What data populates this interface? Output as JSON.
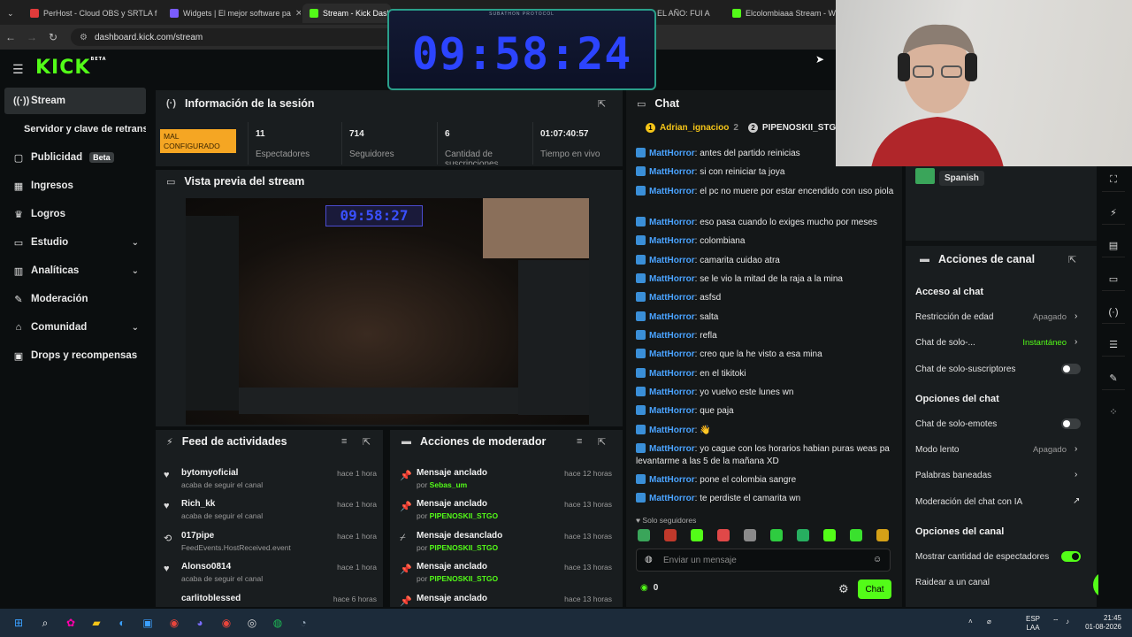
{
  "browser": {
    "tabs": [
      {
        "label": "PerHost - Cloud OBS y SRTLA f",
        "favicon_color": "#e23b3b"
      },
      {
        "label": "Widgets | El mejor software pa",
        "favicon_color": "#7a5cff"
      },
      {
        "label": "Stream - Kick Dashbo",
        "favicon_color": "#53fc18"
      },
      {
        "label": "EL AÑO: FUI A",
        "favicon_color": "#ff2a2a"
      },
      {
        "label": "Elcolombiaaa Stream - Wat",
        "favicon_color": "#53fc18"
      }
    ],
    "url": "dashboard.kick.com/stream"
  },
  "logo": {
    "text": "KICK",
    "sup": "BETA"
  },
  "sidebar": {
    "items": [
      {
        "label": "Stream",
        "icon": "broadcast-icon"
      },
      {
        "label": "Servidor y clave de retransmisión",
        "icon": ""
      },
      {
        "label": "Publicidad",
        "icon": "ad-icon",
        "badge": "Beta"
      },
      {
        "label": "Ingresos",
        "icon": "chart-icon"
      },
      {
        "label": "Logros",
        "icon": "trophy-icon"
      },
      {
        "label": "Estudio",
        "icon": "studio-icon"
      },
      {
        "label": "Analíticas",
        "icon": "analytics-icon"
      },
      {
        "label": "Moderación",
        "icon": "wrench-icon"
      },
      {
        "label": "Comunidad",
        "icon": "community-icon"
      },
      {
        "label": "Drops y recompensas",
        "icon": "gift-icon"
      }
    ]
  },
  "session": {
    "title": "Información de la sesión",
    "status": "MAL CONFIGURADO",
    "stats": [
      {
        "value": "11",
        "label": "Espectadores"
      },
      {
        "value": "714",
        "label": "Seguidores"
      },
      {
        "value": "6",
        "label": "Cantidad de suscripciones"
      },
      {
        "value": "01:07:40:57",
        "label": "Tiempo en vivo"
      }
    ]
  },
  "preview": {
    "title": "Vista previa del stream",
    "mini_timer": "09:58:27"
  },
  "feed": {
    "title": "Feed de actividades",
    "items": [
      {
        "name": "bytomyoficial",
        "desc": "acaba de seguir el canal",
        "time": "hace 1 hora",
        "icon": "heart-icon"
      },
      {
        "name": "Rich_kk",
        "desc": "acaba de seguir el canal",
        "time": "hace 1 hora",
        "icon": "heart-icon"
      },
      {
        "name": "017pipe",
        "desc": "FeedEvents.HostReceived.event",
        "time": "hace 1 hora",
        "icon": "host-icon"
      },
      {
        "name": "Alonso0814",
        "desc": "acaba de seguir el canal",
        "time": "hace 1 hora",
        "icon": "heart-icon"
      },
      {
        "name": "carlitoblessed",
        "desc": "",
        "time": "hace 6 horas",
        "icon": "heart-icon"
      }
    ]
  },
  "modactions": {
    "title": "Acciones de moderador",
    "items": [
      {
        "action": "Mensaje anclado",
        "by": "Sebas_um",
        "time": "hace 12 horas",
        "icon": "pin-icon"
      },
      {
        "action": "Mensaje anclado",
        "by": "PIPENOSKII_STGO",
        "time": "hace 13 horas",
        "icon": "pin-icon"
      },
      {
        "action": "Mensaje desanclado",
        "by": "PIPENOSKII_STGO",
        "time": "hace 13 horas",
        "icon": "unpin-icon"
      },
      {
        "action": "Mensaje anclado",
        "by": "PIPENOSKII_STGO",
        "time": "hace 13 horas",
        "icon": "pin-icon"
      },
      {
        "action": "Mensaje anclado",
        "by": "",
        "time": "hace 13 horas",
        "icon": "pin-icon"
      }
    ],
    "by_prefix": "por"
  },
  "chat": {
    "title": "Chat",
    "top_users": [
      {
        "rank": "1",
        "name": "Adrian_ignacioo",
        "count": "2"
      },
      {
        "rank": "2",
        "name": "PIPENOSKII_STGO",
        "count": "1"
      }
    ],
    "messages": [
      {
        "user": "MattHorror",
        "text": "antes del partido reinicias"
      },
      {
        "user": "MattHorror",
        "text": "si con reiniciar ta joya"
      },
      {
        "user": "MattHorror",
        "text": "el pc no muere por estar encendido con uso piola"
      },
      {
        "user": "MattHorror",
        "text": "eso pasa cuando lo exiges mucho por meses"
      },
      {
        "user": "MattHorror",
        "text": "colombiana"
      },
      {
        "user": "MattHorror",
        "text": "camarita cuidao atra"
      },
      {
        "user": "MattHorror",
        "text": "se le vio la mitad de la raja a la mina"
      },
      {
        "user": "MattHorror",
        "text": "asfsd"
      },
      {
        "user": "MattHorror",
        "text": "salta"
      },
      {
        "user": "MattHorror",
        "text": "refla"
      },
      {
        "user": "MattHorror",
        "text": "creo que la he visto a esa mina"
      },
      {
        "user": "MattHorror",
        "text": "en el tikitoki"
      },
      {
        "user": "MattHorror",
        "text": "yo vuelvo este lunes wn"
      },
      {
        "user": "MattHorror",
        "text": "que paja"
      },
      {
        "user": "MattHorror",
        "text": "👋"
      },
      {
        "user": "MattHorror",
        "text": "yo cague con los horarios habian puras weas pa levantarme a las 5 de la mañana XD"
      },
      {
        "user": "MattHorror",
        "text": "pone el colombia sangre"
      },
      {
        "user": "MattHorror",
        "text": "te perdiste el camarita wn"
      }
    ],
    "followers_only": "Solo seguidores",
    "placeholder": "Enviar un mensaje",
    "points": "0",
    "send_label": "Chat"
  },
  "language": {
    "label": "Spanish"
  },
  "channel_actions": {
    "title": "Acciones de canal",
    "sections": {
      "chat_access": "Acceso al chat",
      "chat_options": "Opciones del chat",
      "channel_options": "Opciones del canal"
    },
    "age_restriction": {
      "label": "Restricción de edad",
      "value": "Apagado"
    },
    "chat_solo": {
      "label": "Chat de solo-...",
      "value": "Instantáneo"
    },
    "subs_only": {
      "label": "Chat de solo-suscriptores"
    },
    "emotes_only": {
      "label": "Chat de solo-emotes"
    },
    "slow_mode": {
      "label": "Modo lento",
      "value": "Apagado"
    },
    "banned_words": {
      "label": "Palabras baneadas"
    },
    "ai_moderation": {
      "label": "Moderación del chat con IA"
    },
    "show_viewers": {
      "label": "Mostrar cantidad de espectadores"
    },
    "raid": {
      "label": "Raidear a un canal"
    }
  },
  "timer_overlay": {
    "label": "SUBATHON PROTOCOL",
    "time": "09:58:24"
  },
  "taskbar": {
    "lang": "ESP",
    "lang2": "LAA",
    "time": "21:45",
    "date": "01-08-2026"
  },
  "colors": {
    "accent": "#53fc18",
    "warning": "#f5a623",
    "username": "#4aa3ff"
  }
}
